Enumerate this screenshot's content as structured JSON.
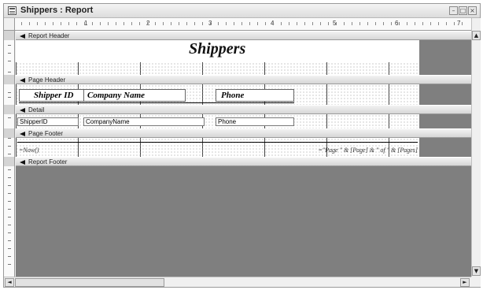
{
  "window": {
    "title": "Shippers : Report",
    "buttons": {
      "minimize": "–",
      "maximize": "□",
      "close": "×"
    }
  },
  "ruler": {
    "numbers": [
      "1",
      "2",
      "3",
      "4",
      "5",
      "6",
      "7"
    ]
  },
  "sections": {
    "report_header": "Report Header",
    "page_header": "Page Header",
    "detail": "Detail",
    "page_footer": "Page Footer",
    "report_footer": "Report Footer"
  },
  "report_title": "Shippers",
  "labels": {
    "shipper_id": "Shipper ID",
    "company_name": "Company Name",
    "phone": "Phone"
  },
  "fields": {
    "shipper_id": "ShipperID",
    "company_name": "CompanyName",
    "phone": "Phone"
  },
  "footer": {
    "date": "=Now()",
    "page": "=\"Page \" & [Page] & \" of \" & [Pages]"
  },
  "scroll": {
    "up": "▲",
    "down": "▼",
    "left": "◄",
    "right": "►"
  }
}
